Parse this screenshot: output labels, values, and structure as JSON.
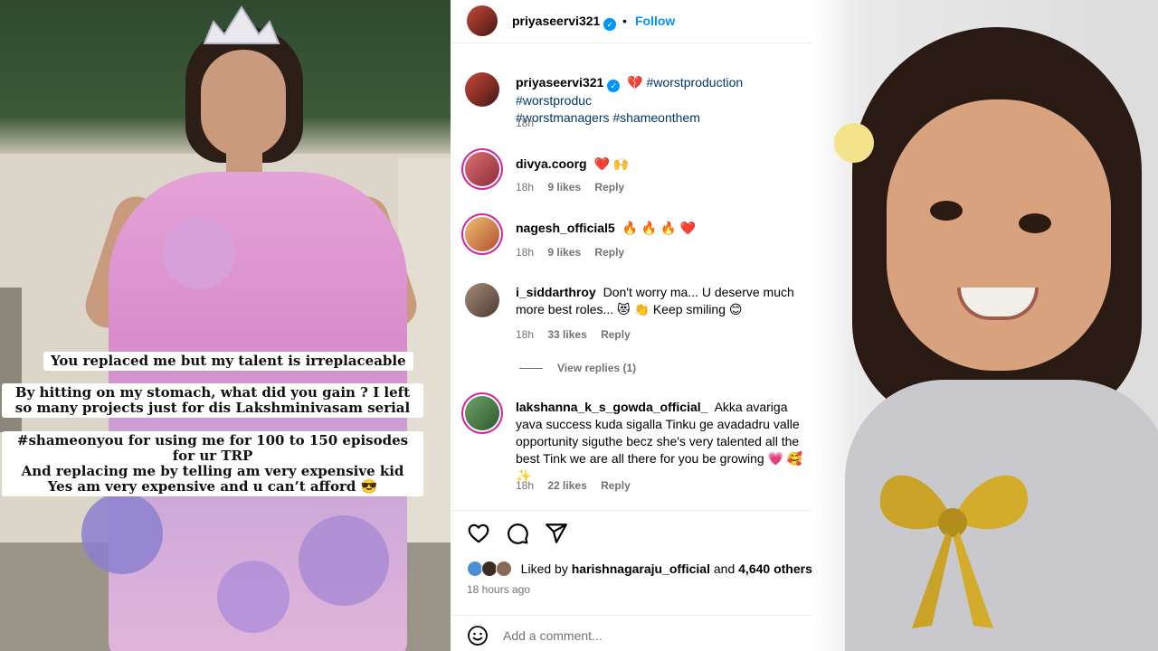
{
  "left_image": {
    "captions": [
      "You replaced me but my talent is irreplaceable",
      "By hitting on my stomach, what did you gain ? I left so many projects just for dis  Lakshminivasam serial",
      "#shameonyou for using me for 100 to 150 episodes for ur TRP\nAnd replacing me by telling am very expensive kid\nYes am very expensive and u can’t afford 😎"
    ]
  },
  "header": {
    "username": "priyaseervi321",
    "separator": "•",
    "follow_label": "Follow"
  },
  "caption": {
    "username": "priyaseervi321",
    "emoji": "💔",
    "hashtags_line1": "#worstproduction #worstproduc",
    "hashtags_line2": "#worstmanagers #shameonthem",
    "time": "18h"
  },
  "comments": [
    {
      "username": "divya.coorg",
      "text": "❤️ 🙌",
      "time": "18h",
      "likes": "9 likes",
      "reply": "Reply"
    },
    {
      "username": "nagesh_official5",
      "text": "🔥 🔥 🔥 ❤️",
      "time": "18h",
      "likes": "9 likes",
      "reply": "Reply"
    },
    {
      "username": "i_siddarthroy",
      "text": "Don't worry ma... U deserve much more best roles... 😻 👏 Keep smiling 😊",
      "time": "18h",
      "likes": "33 likes",
      "reply": "Reply"
    },
    {
      "username": "lakshanna_k_s_gowda_official_",
      "text": "Akka avariga yava success kuda sigalla Tinku ge avadadru valle opportunity siguthe becz she's very talented all the best Tink we are all there for you be growing 💗 🥰 ✨",
      "time": "18h",
      "likes": "22 likes",
      "reply": "Reply"
    }
  ],
  "view_replies": "View replies (1)",
  "likes_summary": {
    "prefix": "Liked by",
    "user": "harishnagaraju_official",
    "and": "and",
    "others": "4,640 others"
  },
  "posted_ago": "18 hours ago",
  "add_comment": {
    "placeholder": "Add a comment..."
  },
  "icons": {
    "heart": "heart-icon",
    "comment": "comment-icon",
    "share": "share-icon",
    "emoji": "emoji-icon",
    "verified": "verified-badge-icon"
  },
  "colors": {
    "link_blue": "#0095f6",
    "hashtag": "#00376b",
    "muted": "#737373",
    "story_ring": "#d6249f"
  }
}
